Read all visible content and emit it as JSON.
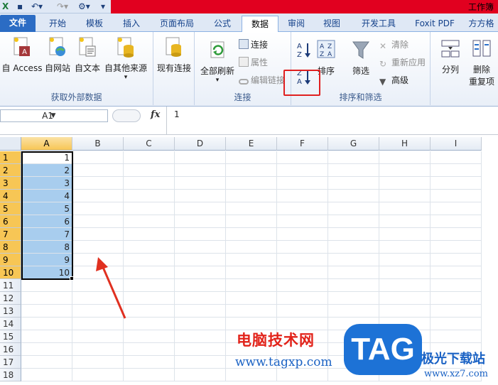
{
  "window": {
    "title": "工作簿"
  },
  "tabs": [
    "文件",
    "开始",
    "模板",
    "插入",
    "页面布局",
    "公式",
    "数据",
    "审阅",
    "视图",
    "开发工具",
    "Foxit PDF",
    "方方格"
  ],
  "ribbon": {
    "get_external": {
      "label": "获取外部数据",
      "buttons": [
        "自 Access",
        "自网站",
        "自文本",
        "自其他来源"
      ]
    },
    "existing": {
      "label": "现有连接"
    },
    "connections": {
      "label": "连接",
      "refresh": "全部刷新",
      "items": [
        "连接",
        "属性",
        "编辑链接"
      ]
    },
    "sort_filter": {
      "label": "排序和筛选",
      "sort": "排序",
      "filter": "筛选",
      "items": [
        "清除",
        "重新应用",
        "高级"
      ]
    },
    "data_tools": {
      "split": "分列",
      "remove_dup_1": "删除",
      "remove_dup_2": "重复项"
    }
  },
  "formula_bar": {
    "name_box": "A1",
    "fx": "fx",
    "value": "1"
  },
  "sheet": {
    "columns": [
      "A",
      "B",
      "C",
      "D",
      "E",
      "F",
      "G",
      "H",
      "I"
    ],
    "rows": [
      "1",
      "2",
      "3",
      "4",
      "5",
      "6",
      "7",
      "8",
      "9",
      "10",
      "11",
      "12",
      "13",
      "14",
      "15",
      "16",
      "17",
      "18"
    ],
    "colA": [
      "1",
      "2",
      "3",
      "4",
      "5",
      "6",
      "7",
      "8",
      "9",
      "10"
    ]
  },
  "watermark": {
    "cn": "电脑技术网",
    "url": "www.tagxp.com",
    "tag": "TAG",
    "site": "极光下载站",
    "url2": "www.xz7.com"
  },
  "colors": {
    "file_tab": "#2b6cc4",
    "selection": "#a8cdee",
    "header_selected": "#f7c655",
    "highlight": "#e02020",
    "title_bar": "#e1001f"
  }
}
